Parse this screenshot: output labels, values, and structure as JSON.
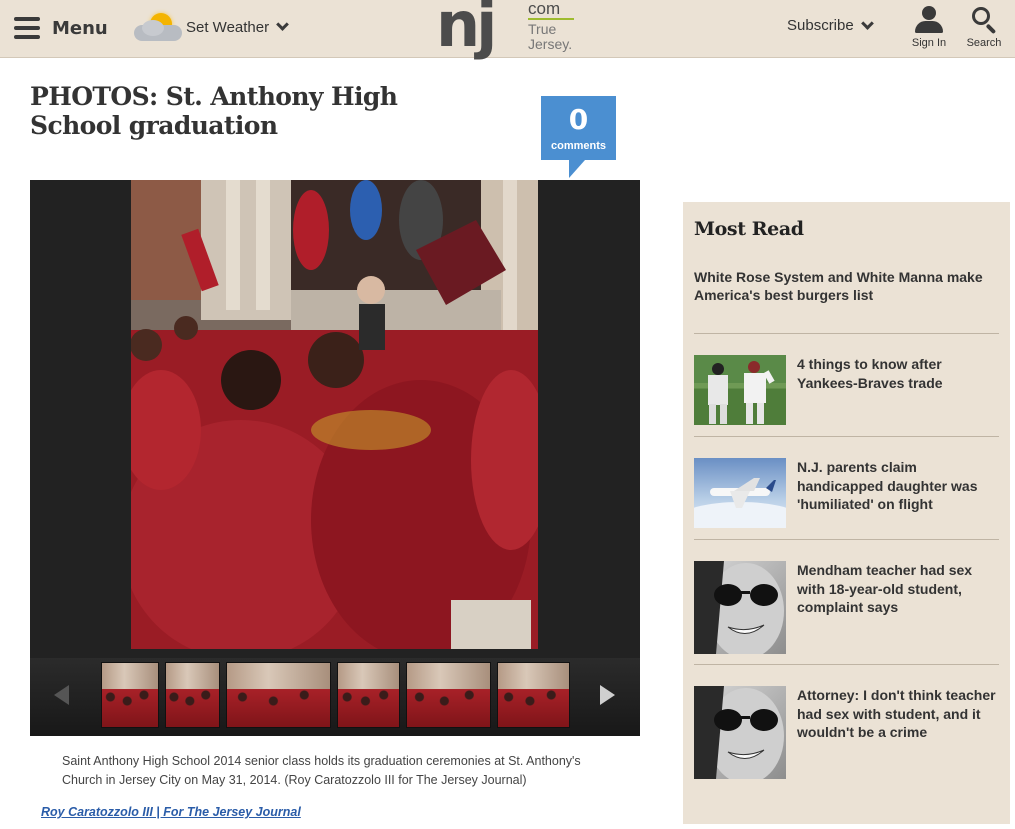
{
  "header": {
    "menu_label": "Menu",
    "weather_label": "Set Weather",
    "logo": {
      "main": "nj",
      "com": "com",
      "tagline_line1": "True",
      "tagline_line2": "Jersey."
    },
    "subscribe_label": "Subscribe",
    "signin_label": "Sign In",
    "search_label": "Search"
  },
  "article": {
    "title": "PHOTOS: St. Anthony High School graduation",
    "comments": {
      "count": "0",
      "label": "comments"
    },
    "gallery": {
      "thumbnail_count": 6
    },
    "caption": "Saint Anthony High School 2014 senior class holds its graduation ceremonies at St. Anthony's Church in Jersey City on May 31, 2014. (Roy Caratozzolo III for The Jersey Journal)",
    "credit": "Roy Caratozzolo III | For The Jersey Journal"
  },
  "sidebar": {
    "heading": "Most Read",
    "top_story": "White Rose System and White Manna make America's best burgers list",
    "stories": [
      {
        "title": "4 things to know after Yankees-Braves trade",
        "thumb": "baseball-players-photo"
      },
      {
        "title": "N.J. parents claim handicapped daughter was 'humiliated' on flight",
        "thumb": "airplane-photo"
      },
      {
        "title": "Mendham teacher had sex with 18-year-old student, complaint says",
        "thumb": "woman-sunglasses-photo"
      },
      {
        "title": "Attorney: I don't think teacher had sex with student, and it wouldn't be a crime",
        "thumb": "woman-sunglasses-photo"
      }
    ]
  },
  "colors": {
    "header_bg": "#ebe2d5",
    "sidebar_bg": "#ebe2d5",
    "comments_blue": "#4b8fd1",
    "link_blue": "#2a5ca8",
    "logo_green": "#9ebb2f"
  }
}
